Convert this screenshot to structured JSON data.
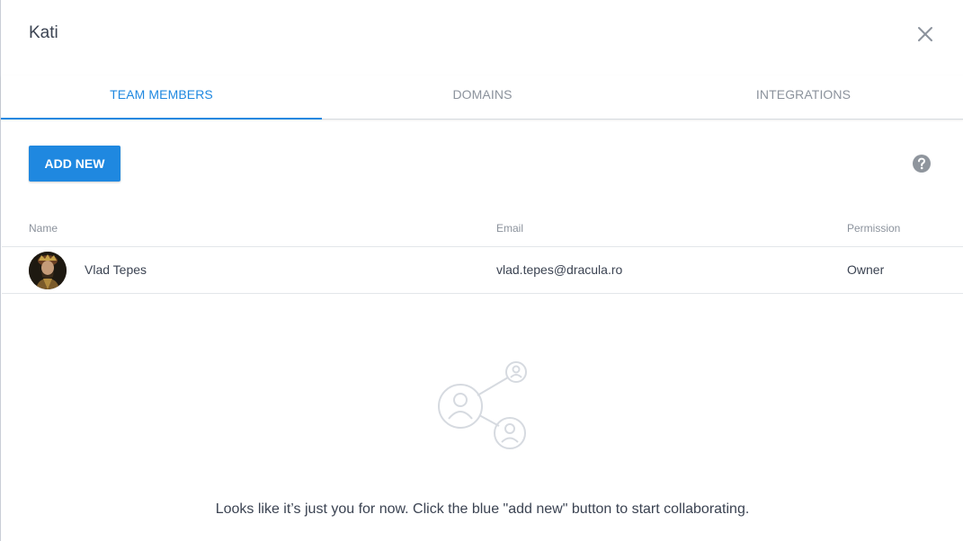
{
  "dialog": {
    "title": "Kati",
    "close_icon": "close-icon"
  },
  "tabs": [
    {
      "label": "TEAM MEMBERS",
      "active": true
    },
    {
      "label": "DOMAINS",
      "active": false
    },
    {
      "label": "INTEGRATIONS",
      "active": false
    }
  ],
  "toolbar": {
    "add_new_label": "ADD NEW",
    "help_icon": "help-icon"
  },
  "table": {
    "columns": [
      "Name",
      "Email",
      "Permission"
    ],
    "rows": [
      {
        "name": "Vlad Tepes",
        "email": "vlad.tepes@dracula.ro",
        "permission": "Owner"
      }
    ]
  },
  "empty_state": {
    "icon": "team-share-icon",
    "message": "Looks like it’s just you for now. Click the blue \"add new\" button to start collaborating."
  },
  "colors": {
    "accent": "#1f88e0",
    "text": "#3b4352",
    "muted": "#8b929c",
    "divider": "#e3e6ea"
  }
}
